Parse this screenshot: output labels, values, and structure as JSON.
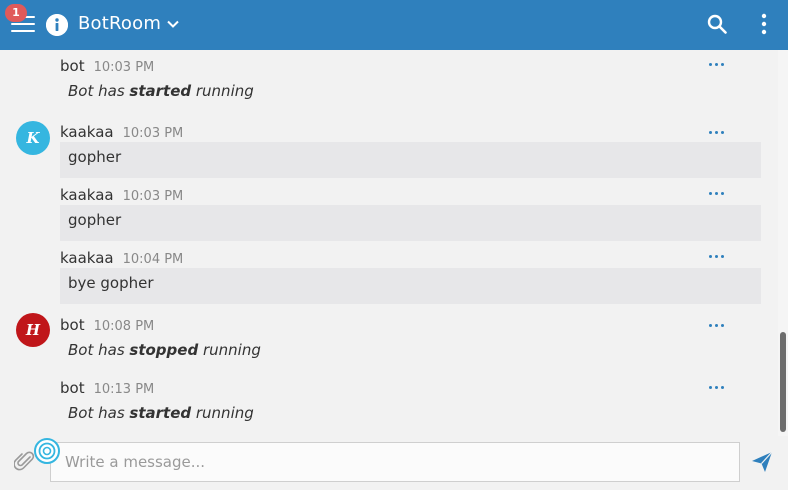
{
  "header": {
    "menu_icon": "hamburger-menu-icon",
    "unread_badge": "1",
    "info_icon": "info-circle-icon",
    "room_name": "BotRoom",
    "room_chevron_icon": "chevron-down-icon",
    "search_icon": "search-icon",
    "more_icon": "kebab-menu-icon",
    "bg_color": "#2f80bd",
    "badge_color": "#e05a5a"
  },
  "messages": [
    {
      "sender": "bot",
      "time": "10:03 PM",
      "type": "system",
      "text_before": "Bot has ",
      "text_bold": "started",
      "text_after": " running"
    },
    {
      "sender": "kaakaa",
      "time": "10:03 PM",
      "type": "text",
      "text": "gopher",
      "avatar_letter": "K",
      "avatar_color": "#35b6e0"
    },
    {
      "sender": "kaakaa",
      "time": "10:03 PM",
      "type": "text",
      "text": "gopher"
    },
    {
      "sender": "kaakaa",
      "time": "10:04 PM",
      "type": "text",
      "text": "bye gopher"
    },
    {
      "sender": "bot",
      "time": "10:08 PM",
      "type": "system",
      "text_before": "Bot has ",
      "text_bold": "stopped",
      "text_after": " running",
      "avatar_letter": "H",
      "avatar_color": "#c0161a"
    },
    {
      "sender": "bot",
      "time": "10:13 PM",
      "type": "system",
      "text_before": "Bot has ",
      "text_bold": "started",
      "text_after": " running"
    }
  ],
  "composer": {
    "placeholder": "Write a message...",
    "attach_icon": "paperclip-icon",
    "emoji_icon": "emoji-icon",
    "send_icon": "send-icon"
  },
  "accent_color": "#2f80bd"
}
